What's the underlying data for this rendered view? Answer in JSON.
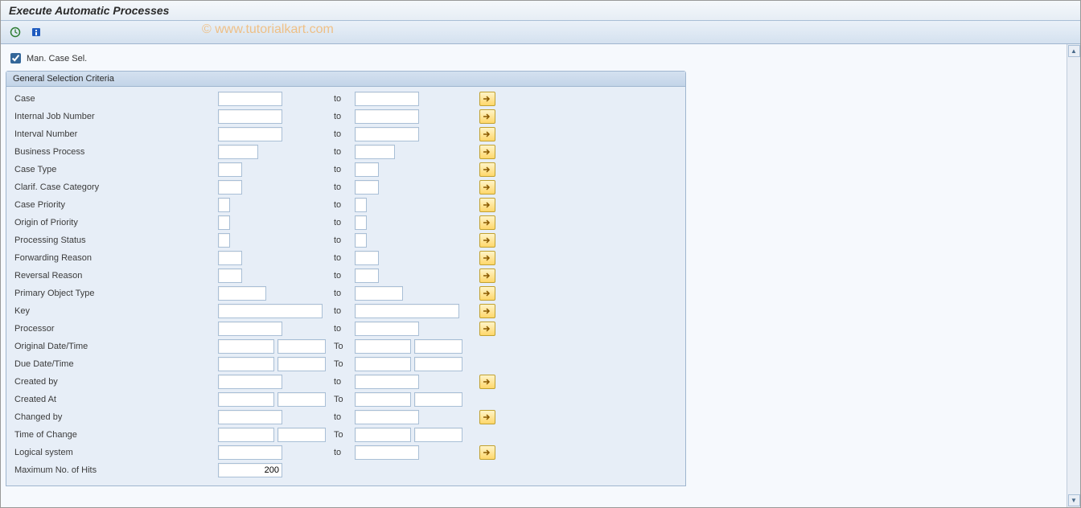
{
  "title": "Execute Automatic Processes",
  "watermark": "© www.tutorialkart.com",
  "checkbox": {
    "label": "Man. Case Sel.",
    "checked": true
  },
  "group": {
    "title": "General Selection Criteria",
    "to_lc": "to",
    "to_uc": "To",
    "rows": {
      "case": {
        "label": "Case"
      },
      "internal_job": {
        "label": "Internal Job Number"
      },
      "interval_number": {
        "label": "Interval Number"
      },
      "business_process": {
        "label": "Business Process"
      },
      "case_type": {
        "label": "Case Type"
      },
      "clarif_cat": {
        "label": "Clarif. Case Category"
      },
      "case_priority": {
        "label": "Case Priority"
      },
      "origin_priority": {
        "label": "Origin of Priority"
      },
      "proc_status": {
        "label": "Processing Status"
      },
      "fwd_reason": {
        "label": "Forwarding Reason"
      },
      "rev_reason": {
        "label": "Reversal Reason"
      },
      "prim_obj_type": {
        "label": "Primary Object Type"
      },
      "key": {
        "label": "Key"
      },
      "processor": {
        "label": "Processor"
      },
      "orig_dt": {
        "label": "Original Date/Time"
      },
      "due_dt": {
        "label": "Due Date/Time"
      },
      "created_by": {
        "label": "Created by"
      },
      "created_at": {
        "label": "Created At"
      },
      "changed_by": {
        "label": "Changed by"
      },
      "time_change": {
        "label": "Time of Change"
      },
      "logical_system": {
        "label": "Logical system"
      },
      "max_hits": {
        "label": "Maximum No. of Hits",
        "value": "200"
      }
    }
  }
}
